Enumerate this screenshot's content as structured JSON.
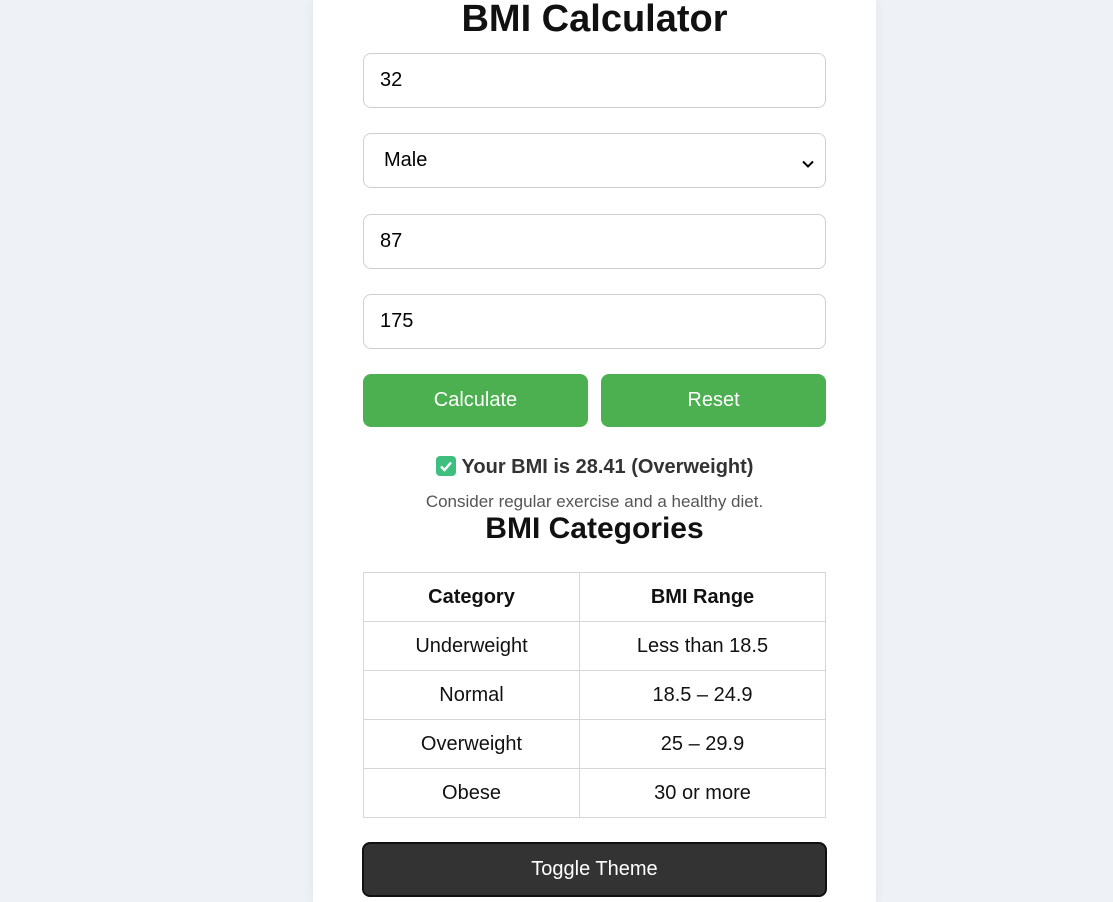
{
  "app": {
    "title": "BMI Calculator"
  },
  "form": {
    "age_value": "32",
    "gender_selected": "Male",
    "weight_value": "87",
    "height_value": "175"
  },
  "buttons": {
    "calculate_label": "Calculate",
    "reset_label": "Reset",
    "toggle_theme_label": "Toggle Theme"
  },
  "result": {
    "icon": "check-mark-icon",
    "text": "Your BMI is 28.41 (Overweight)",
    "advice": "Consider regular exercise and a healthy diet."
  },
  "categories": {
    "title": "BMI Categories",
    "headers": [
      "Category",
      "BMI Range"
    ],
    "rows": [
      [
        "Underweight",
        "Less than 18.5"
      ],
      [
        "Normal",
        "18.5 – 24.9"
      ],
      [
        "Overweight",
        "25 – 29.9"
      ],
      [
        "Obese",
        "30 or more"
      ]
    ]
  },
  "colors": {
    "accent": "#4caf50",
    "toggle_bg": "#333333",
    "page_bg": "#eef2f7",
    "check_icon": "#3fbf7f"
  }
}
